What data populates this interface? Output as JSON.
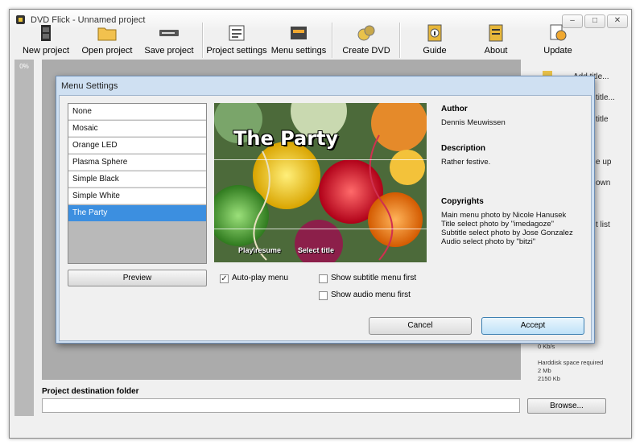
{
  "window": {
    "title": "DVD Flick - Unnamed project",
    "min": "–",
    "max": "□",
    "close": "✕"
  },
  "toolbar": [
    {
      "label": "New project",
      "icon": "film-icon"
    },
    {
      "label": "Open project",
      "icon": "folder-icon"
    },
    {
      "label": "Save project",
      "icon": "disk-drive-icon"
    },
    {
      "label": "Project settings",
      "icon": "settings-icon"
    },
    {
      "label": "Menu settings",
      "icon": "menu-icon"
    },
    {
      "label": "Create DVD",
      "icon": "disc-icon"
    },
    {
      "label": "Guide",
      "icon": "info-book-icon"
    },
    {
      "label": "About",
      "icon": "document-icon"
    },
    {
      "label": "Update",
      "icon": "update-icon"
    }
  ],
  "progress": {
    "label": "0%"
  },
  "side_panel": {
    "items": [
      "Add title...",
      "title...",
      "title",
      "e up",
      "own",
      "t list"
    ],
    "disk_info": [
      "0 Kb/s",
      "Harddisk space required",
      "2 Mb",
      "2150 Kb"
    ]
  },
  "destination": {
    "label": "Project destination folder",
    "value": "",
    "browse": "Browse..."
  },
  "dialog": {
    "title": "Menu Settings",
    "themes": [
      "None",
      "Mosaic",
      "Orange LED",
      "Plasma Sphere",
      "Simple Black",
      "Simple White",
      "The Party"
    ],
    "selected_theme": 6,
    "preview_button": "Preview",
    "preview": {
      "title": "The Party",
      "play": "Play\\resume",
      "select": "Select title"
    },
    "author_heading": "Author",
    "author": "Dennis Meuwissen",
    "description_heading": "Description",
    "description": "Rather festive.",
    "copyrights_heading": "Copyrights",
    "copyrights": [
      "Main menu photo by Nicole Hanusek",
      "Title select photo by \"imedagoze\"",
      "Subtitle select photo by Jose Gonzalez",
      "Audio select photo by \"bitzi\""
    ],
    "options": {
      "autoplay": {
        "label": "Auto-play menu",
        "checked": true
      },
      "subtitle_first": {
        "label": "Show subtitle menu first",
        "checked": false
      },
      "audio_first": {
        "label": "Show audio menu first",
        "checked": false
      }
    },
    "cancel": "Cancel",
    "accept": "Accept"
  },
  "colors": {
    "accent": "#3c8fe0",
    "dialog_frame": "#cfe0f2",
    "background": "#f0f0f0"
  }
}
